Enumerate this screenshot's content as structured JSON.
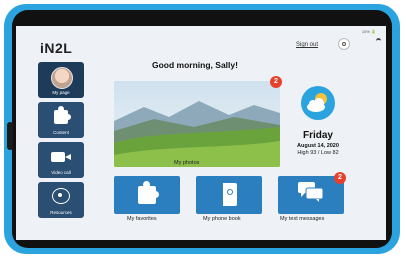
{
  "status": {
    "text": "10% 🔋"
  },
  "app": {
    "logo": "iN2L"
  },
  "header": {
    "signout_label": "Sign out",
    "greeting": "Good morning, Sally!"
  },
  "sidebar": {
    "items": [
      {
        "label": "My page",
        "icon": "user-avatar"
      },
      {
        "label": "Content",
        "icon": "puzzle-icon"
      },
      {
        "label": "Video call",
        "icon": "camera-icon"
      },
      {
        "label": "Resources",
        "icon": "people-icon"
      }
    ]
  },
  "photos": {
    "label": "My photos",
    "badge": "2"
  },
  "weather": {
    "day": "Friday",
    "date": "August 14, 2020",
    "hilo": "High 93 / Low 82",
    "icon": "partly-cloudy-icon"
  },
  "tiles": [
    {
      "label": "My favorites",
      "icon": "puzzle-icon"
    },
    {
      "label": "My phone book",
      "icon": "phone-book-icon"
    },
    {
      "label": "My text messages",
      "icon": "chat-icon",
      "badge": "2"
    }
  ],
  "colors": {
    "frame": "#2aa3df",
    "sidebar": "#2b4e73",
    "tile": "#2c7fbf",
    "badge": "#e8412b"
  }
}
